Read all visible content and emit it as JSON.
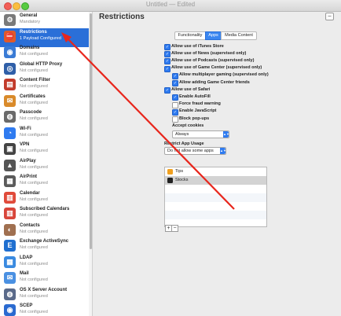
{
  "window": {
    "title": "Untitled — Edited"
  },
  "sidebar": {
    "items": [
      {
        "name": "General",
        "sub": "Mandatory",
        "icon": "gear-icon",
        "color": "#7a7a7a",
        "glyph": "⚙"
      },
      {
        "name": "Restrictions",
        "sub": "1 Payload Configured",
        "icon": "restrictions-icon",
        "color": "#e05a2a",
        "glyph": "⛔",
        "selected": true
      },
      {
        "name": "Domains",
        "sub": "Not configured",
        "icon": "globe-icon",
        "color": "#3a7bd5",
        "glyph": "◉"
      },
      {
        "name": "Global HTTP Proxy",
        "sub": "Not configured",
        "icon": "proxy-icon",
        "color": "#2f5fa8",
        "glyph": "◎"
      },
      {
        "name": "Content Filter",
        "sub": "Not configured",
        "icon": "filter-icon",
        "color": "#c23b2b",
        "glyph": "▤"
      },
      {
        "name": "Certificates",
        "sub": "Not configured",
        "icon": "certificate-icon",
        "color": "#d98a2a",
        "glyph": "✉"
      },
      {
        "name": "Passcode",
        "sub": "Not configured",
        "icon": "passcode-icon",
        "color": "#6a6a6a",
        "glyph": "◍"
      },
      {
        "name": "Wi-Fi",
        "sub": "Not configured",
        "icon": "wifi-icon",
        "color": "#2f7bf0",
        "glyph": "◔"
      },
      {
        "name": "VPN",
        "sub": "Not configured",
        "icon": "vpn-icon",
        "color": "#444444",
        "glyph": "▣"
      },
      {
        "name": "AirPlay",
        "sub": "Not configured",
        "icon": "airplay-icon",
        "color": "#555555",
        "glyph": "▲"
      },
      {
        "name": "AirPrint",
        "sub": "Not configured",
        "icon": "airprint-icon",
        "color": "#5a5a5a",
        "glyph": "▦"
      },
      {
        "name": "Calendar",
        "sub": "Not configured",
        "icon": "calendar-icon",
        "color": "#e04a3a",
        "glyph": "▥"
      },
      {
        "name": "Subscribed Calendars",
        "sub": "Not configured",
        "icon": "subscribed-calendars-icon",
        "color": "#d8453a",
        "glyph": "▥"
      },
      {
        "name": "Contacts",
        "sub": "Not configured",
        "icon": "contacts-icon",
        "color": "#a07050",
        "glyph": "◐"
      },
      {
        "name": "Exchange ActiveSync",
        "sub": "Not configured",
        "icon": "exchange-icon",
        "color": "#1f6fd0",
        "glyph": "E"
      },
      {
        "name": "LDAP",
        "sub": "Not configured",
        "icon": "ldap-icon",
        "color": "#3a8ae0",
        "glyph": "▦"
      },
      {
        "name": "Mail",
        "sub": "Not configured",
        "icon": "mail-icon",
        "color": "#4a90e2",
        "glyph": "✉"
      },
      {
        "name": "OS X Server Account",
        "sub": "Not configured",
        "icon": "server-account-icon",
        "color": "#5a6a8a",
        "glyph": "◍"
      },
      {
        "name": "SCEP",
        "sub": "Not configured",
        "icon": "scep-icon",
        "color": "#2a6ad0",
        "glyph": "◉"
      }
    ]
  },
  "main": {
    "title": "Restrictions",
    "tabs": [
      {
        "label": "Functionality"
      },
      {
        "label": "Apps",
        "active": true
      },
      {
        "label": "Media Content"
      }
    ],
    "options": [
      {
        "label": "Allow use of iTunes Store",
        "checked": true
      },
      {
        "label": "Allow use of News (supervised only)",
        "checked": true
      },
      {
        "label": "Allow use of Podcasts (supervised only)",
        "checked": true
      },
      {
        "label": "Allow use of Game Center (supervised only)",
        "checked": true
      },
      {
        "label": "Allow multiplayer gaming (supervised only)",
        "checked": true,
        "indent": true
      },
      {
        "label": "Allow adding Game Center friends",
        "checked": true,
        "indent": true
      },
      {
        "label": "Allow use of Safari",
        "checked": true
      },
      {
        "label": "Enable AutoFill",
        "checked": true,
        "indent": true
      },
      {
        "label": "Force fraud warning",
        "checked": false,
        "indent": true
      },
      {
        "label": "Enable JavaScript",
        "checked": true,
        "indent": true
      },
      {
        "label": "Block pop-ups",
        "checked": false,
        "indent": true
      }
    ],
    "accept_cookies": {
      "label": "Accept cookies",
      "value": "Always"
    },
    "restrict_app_usage": {
      "label": "Restrict App Usage",
      "value": "Do not allow some apps"
    },
    "apps": [
      {
        "name": "Tips",
        "icon": "tips-icon",
        "color": "#f0a020"
      },
      {
        "name": "Stocks",
        "icon": "stocks-icon",
        "color": "#222222",
        "selected": true
      }
    ],
    "add_label": "+",
    "remove_label": "−"
  }
}
